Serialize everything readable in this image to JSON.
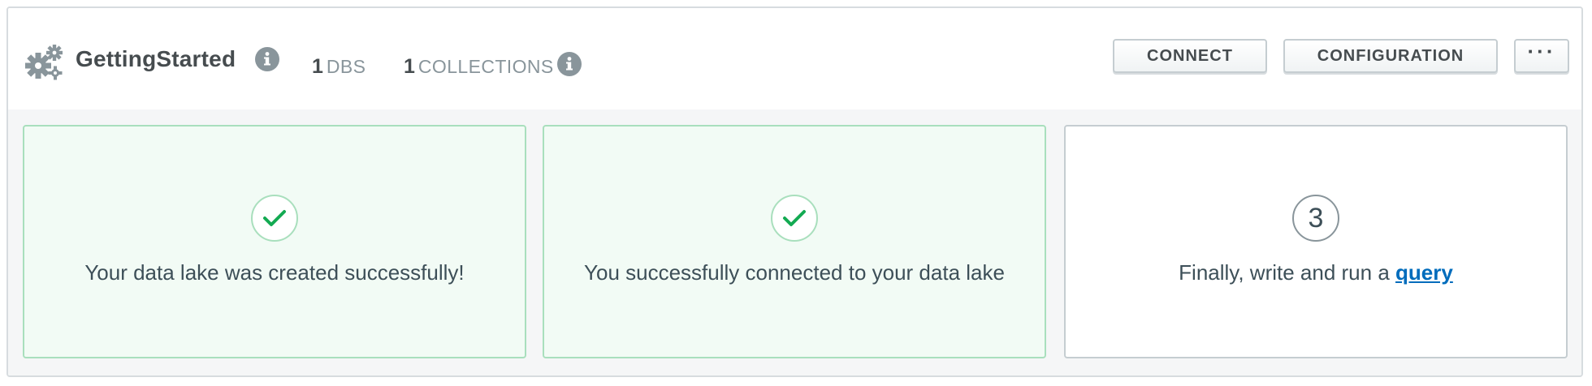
{
  "cluster": {
    "name": "GettingStarted",
    "gear_icon": "gears-icon",
    "info_icon": "info-icon"
  },
  "stats": [
    {
      "value": "1",
      "label": "DBS"
    },
    {
      "value": "1",
      "label": "COLLECTIONS"
    }
  ],
  "actions": {
    "connect_label": "CONNECT",
    "configuration_label": "CONFIGURATION",
    "more_label": "···"
  },
  "steps": [
    {
      "status": "complete",
      "icon": "checkmark-icon",
      "text": "Your data lake was created successfully!"
    },
    {
      "status": "complete",
      "icon": "checkmark-icon",
      "text": "You successfully connected to your data lake"
    },
    {
      "status": "pending",
      "number": "3",
      "text_prefix": "Finally, write and run a ",
      "link_text": "query"
    }
  ],
  "colors": {
    "success_border": "#a9dfbd",
    "success_bg": "#f2fbf5",
    "check_green": "#13aa52",
    "link_blue": "#006cbc",
    "muted": "#89959b"
  }
}
